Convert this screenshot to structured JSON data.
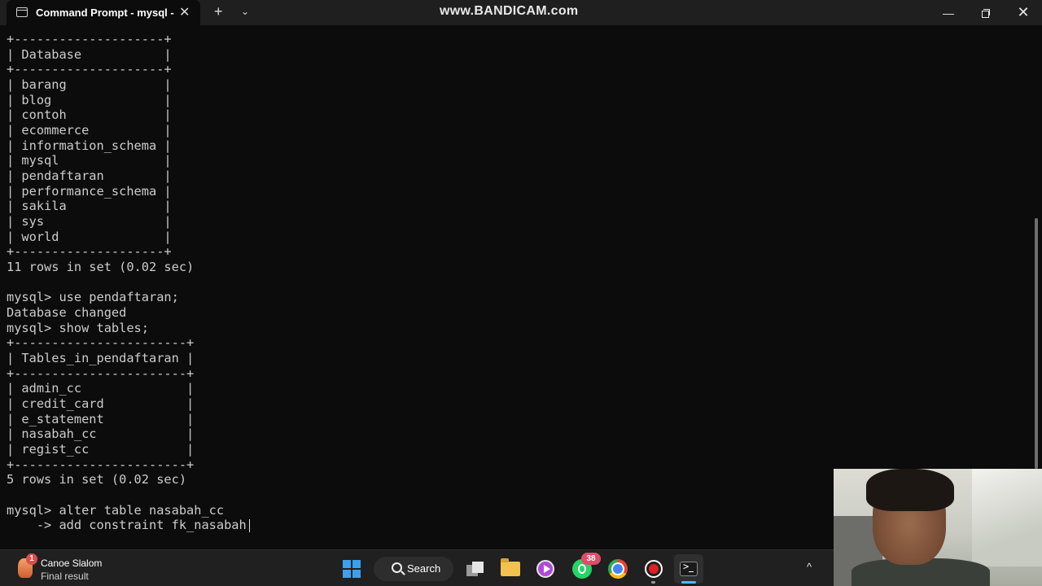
{
  "window": {
    "tab_title": "Command Prompt - mysql  -u",
    "close_symbol": "✕",
    "new_tab_symbol": "+",
    "dropdown_symbol": "⌄",
    "watermark": "www.BANDICAM.com",
    "minimize_symbol": "—",
    "close_window_symbol": "✕"
  },
  "terminal": {
    "lines": [
      "+--------------------+",
      "| Database           |",
      "+--------------------+",
      "| barang             |",
      "| blog               |",
      "| contoh             |",
      "| ecommerce          |",
      "| information_schema |",
      "| mysql              |",
      "| pendaftaran        |",
      "| performance_schema |",
      "| sakila             |",
      "| sys                |",
      "| world              |",
      "+--------------------+",
      "11 rows in set (0.02 sec)",
      "",
      "mysql> use pendaftaran;",
      "Database changed",
      "mysql> show tables;",
      "+-----------------------+",
      "| Tables_in_pendaftaran |",
      "+-----------------------+",
      "| admin_cc              |",
      "| credit_card           |",
      "| e_statement           |",
      "| nasabah_cc            |",
      "| regist_cc             |",
      "+-----------------------+",
      "5 rows in set (0.02 sec)",
      "",
      "mysql> alter table nasabah_cc",
      "    -> add constraint fk_nasabah"
    ]
  },
  "taskbar": {
    "widget": {
      "title": "Canoe Slalom",
      "subtitle": "Final result",
      "badge": "1"
    },
    "search_label": "Search",
    "whatsapp_badge": "38",
    "tray_chevron": "^",
    "accent_color": "#5fb2ff"
  }
}
